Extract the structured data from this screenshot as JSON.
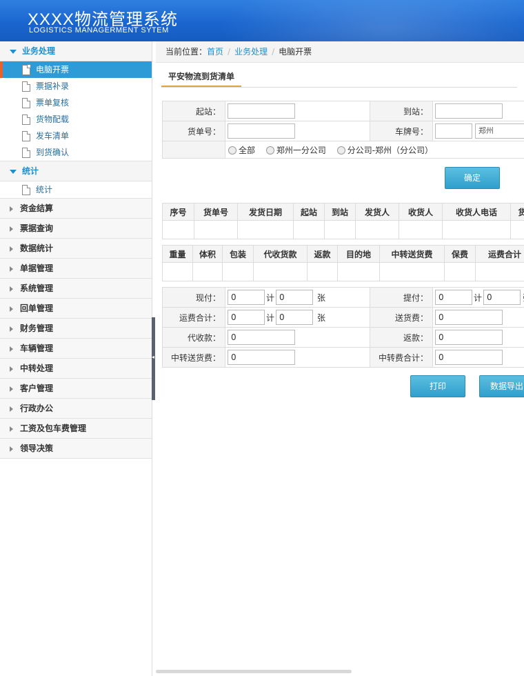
{
  "header": {
    "title": "XXXX物流管理系统",
    "subtitle": "LOGISTICS MANAGERMENT SYTEM"
  },
  "sidebar": {
    "groups": [
      {
        "label": "业务处理",
        "open": true,
        "items": [
          "电脑开票",
          "票据补录",
          "票单复核",
          "货物配载",
          "发车清单",
          "到货确认"
        ]
      },
      {
        "label": "统计",
        "open": true,
        "items": [
          "统计"
        ]
      },
      {
        "label": "资金结算"
      },
      {
        "label": "票据查询"
      },
      {
        "label": "数据统计"
      },
      {
        "label": "单据管理"
      },
      {
        "label": "系统管理"
      },
      {
        "label": "回单管理"
      },
      {
        "label": "财务管理"
      },
      {
        "label": "车辆管理"
      },
      {
        "label": "中转处理"
      },
      {
        "label": "客户管理"
      },
      {
        "label": "行政办公"
      },
      {
        "label": "工资及包车费管理"
      },
      {
        "label": "领导决策"
      }
    ]
  },
  "breadcrumb": {
    "prefix": "当前位置：",
    "items": [
      "首页",
      "业务处理",
      "电脑开票"
    ]
  },
  "tab": {
    "label": "平安物流到货清单"
  },
  "search": {
    "start_label": "起站：",
    "arrive_label": "到站：",
    "waybill_label": "货单号：",
    "plate_label": "车牌号：",
    "plate_city": "郑州",
    "radios": [
      "全部",
      "郑州一分公司",
      "分公司-郑州（分公司）"
    ],
    "confirm": "确定"
  },
  "grid1": {
    "columns": [
      "序号",
      "货单号",
      "发货日期",
      "起站",
      "到站",
      "发货人",
      "收货人",
      "收货人电话",
      "货"
    ]
  },
  "grid2": {
    "columns": [
      "重量",
      "体积",
      "包装",
      "代收货款",
      "返款",
      "目的地",
      "中转送货费",
      "保费",
      "运费合计"
    ]
  },
  "summary": {
    "cash_label": "现付：",
    "cash_value": "0",
    "cash_count": "0",
    "pickup_label": "提付：",
    "pickup_value": "0",
    "pickup_count": "0",
    "freight_label": "运费合计：",
    "freight_value": "0",
    "freight_count": "0",
    "delivery_label": "送货费：",
    "delivery_value": "0",
    "cod_label": "代收款：",
    "cod_value": "0",
    "refund_label": "返款：",
    "refund_value": "0",
    "transfer_label": "中转送货费：",
    "transfer_value": "0",
    "transfer_total_label": "中转费合计：",
    "transfer_total_value": "0",
    "ji": "计",
    "zhang": "张",
    "zhang_cut": "张"
  },
  "actions": {
    "print": "打印",
    "export": "数据导出"
  }
}
